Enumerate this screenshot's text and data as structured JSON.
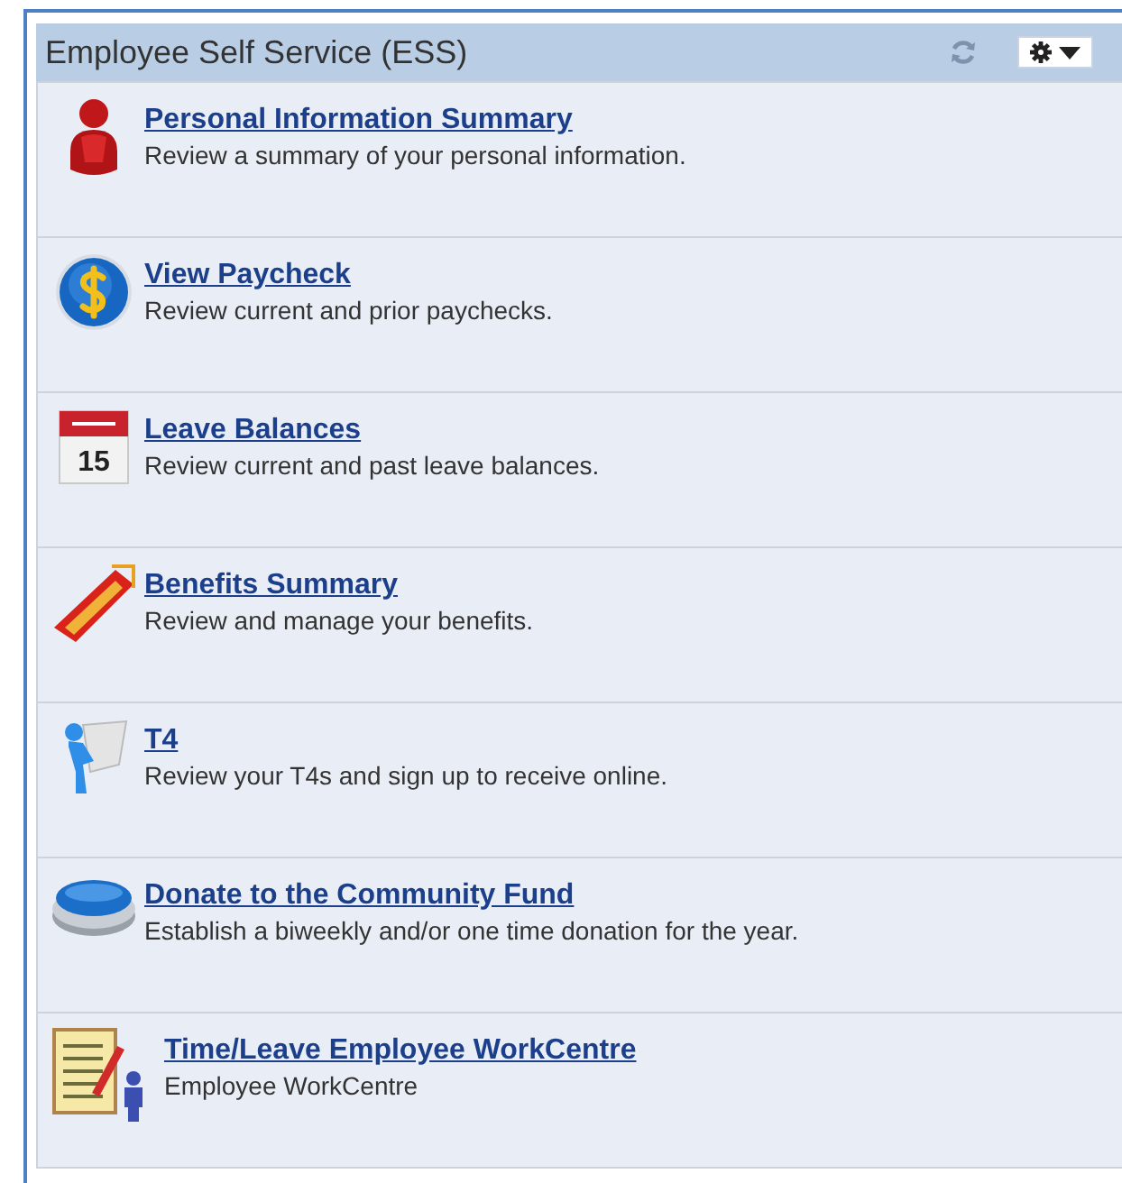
{
  "panel": {
    "title": "Employee Self Service (ESS)"
  },
  "items": [
    {
      "kind": "person",
      "title": "Personal Information Summary",
      "description": "Review a summary of your personal information."
    },
    {
      "kind": "coin",
      "title": "View Paycheck",
      "description": "Review current and prior paychecks."
    },
    {
      "kind": "calendar",
      "title": "Leave Balances",
      "description": "Review current and past leave balances.",
      "icon_label": "15"
    },
    {
      "kind": "ticket",
      "title": "Benefits Summary",
      "description": "Review and manage your benefits."
    },
    {
      "kind": "figure",
      "title": "T4",
      "description": "Review your T4s and sign up to receive online."
    },
    {
      "kind": "pushbutton",
      "title": "Donate to the Community Fund",
      "description": "Establish a biweekly and/or one time donation for the year."
    },
    {
      "kind": "checklist",
      "title": "Time/Leave Employee WorkCentre",
      "description": "Employee WorkCentre"
    }
  ]
}
